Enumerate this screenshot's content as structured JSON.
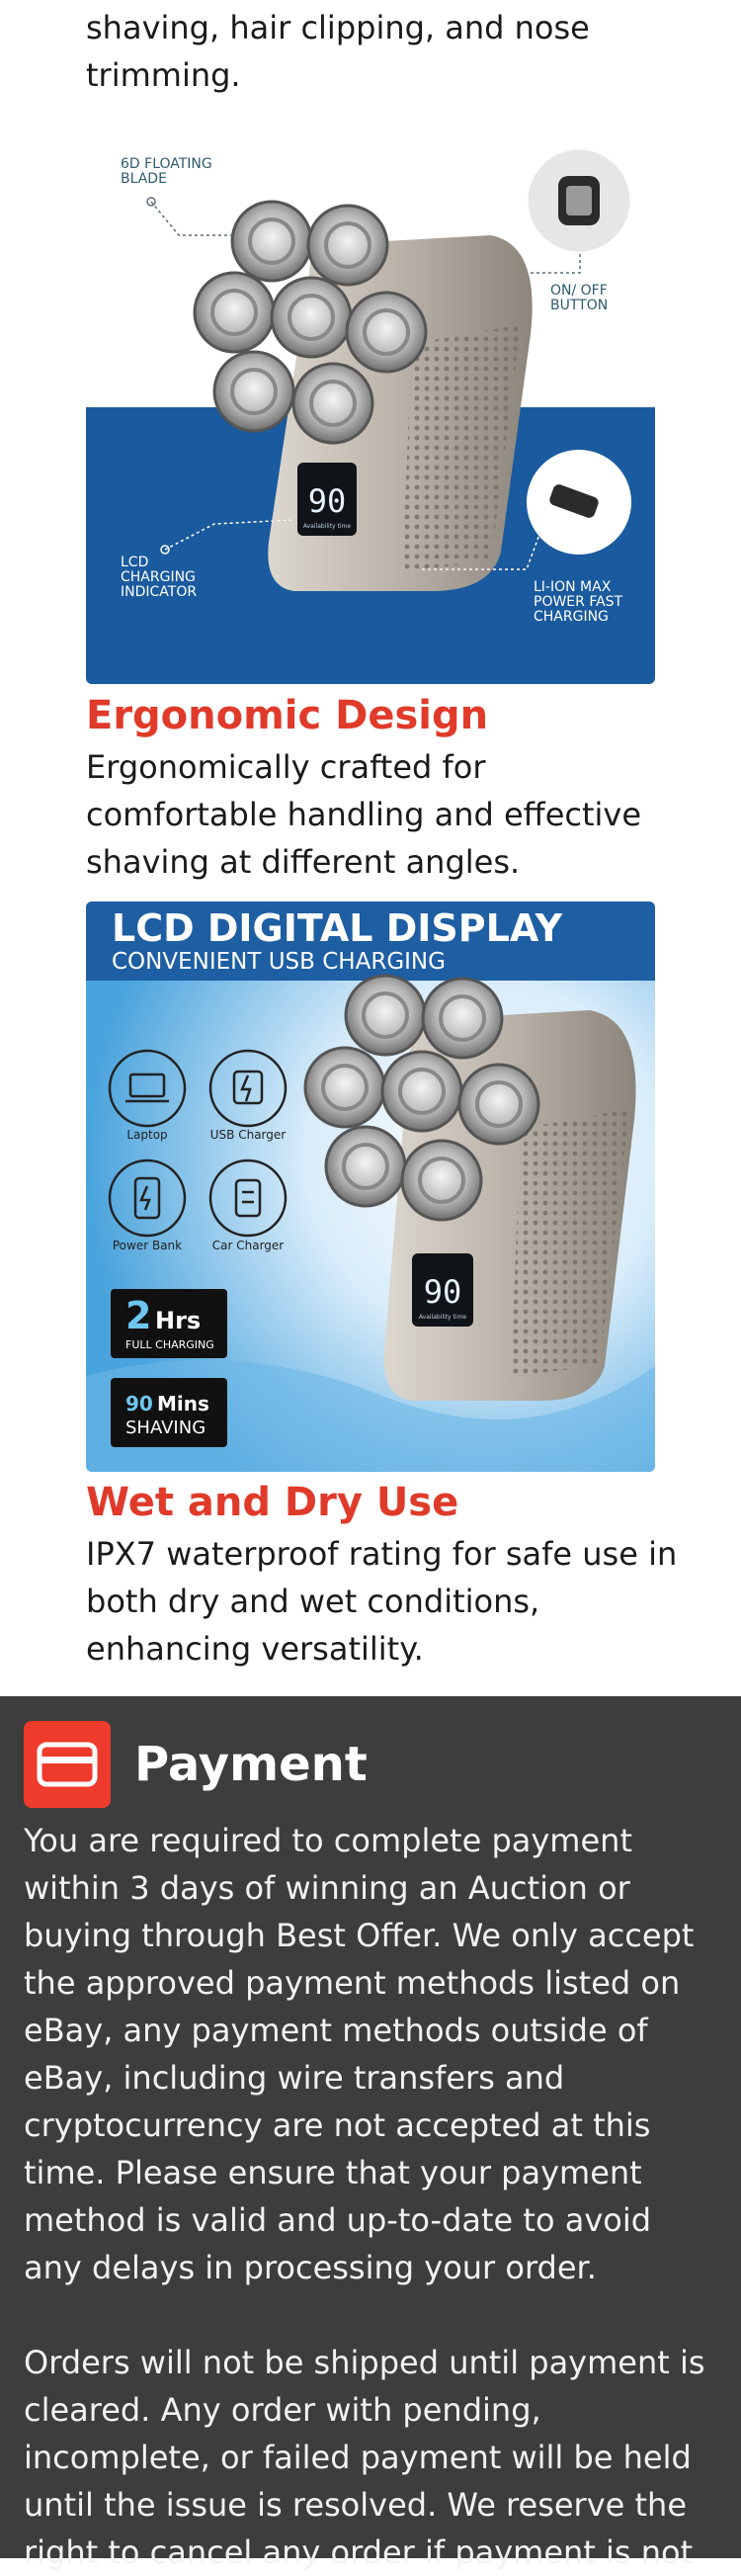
{
  "intro": {
    "text_tail": "shaving, hair clipping, and nose trimming."
  },
  "image1": {
    "blade_label": "6D FLOATING BLADE",
    "onoff_label": "ON/ OFF BUTTON",
    "lcd_label": "LCD CHARGING INDICATOR",
    "liion_label": "LI-ION MAX POWER FAST CHARGING",
    "screen_number": "90",
    "screen_sub": "Availability time"
  },
  "features": [
    {
      "heading": "Ergonomic Design",
      "text": "Ergonomically crafted for comfortable handling and effective shaving at different angles."
    },
    {
      "heading": "Wet and Dry Use",
      "text": "IPX7 waterproof rating for safe use in both dry and wet conditions, enhancing versatility."
    }
  ],
  "image2": {
    "title": "LCD DIGITAL DISPLAY",
    "subtitle": "CONVENIENT USB CHARGING",
    "icons": [
      {
        "label": "Laptop",
        "icon": "laptop-icon"
      },
      {
        "label": "USB Charger",
        "icon": "usb-charger-icon"
      },
      {
        "label": "Power Bank",
        "icon": "power-bank-icon"
      },
      {
        "label": "Car Charger",
        "icon": "car-charger-icon"
      }
    ],
    "badge1_big": "2",
    "badge1_unit": "Hrs",
    "badge1_sub": "FULL CHARGING",
    "badge2_big": "90",
    "badge2_unit": "Mins",
    "badge2_sub": "SHAVING",
    "screen_number": "90",
    "screen_sub": "Availability time"
  },
  "payment": {
    "icon": "credit-card-icon",
    "title": "Payment",
    "paragraph1": "You are required to complete payment within 3 days of winning an Auction or buying through Best Offer. We only accept the approved payment methods listed on eBay, any payment methods outside of eBay, including wire transfers and cryptocurrency are not accepted at this time. Please ensure that your payment method is valid and up-to-date to avoid any delays in processing your order.",
    "paragraph2": "Orders will not be shipped until payment is cleared. Any order with pending, incomplete, or failed payment will be held until the issue is resolved. We reserve the right to cancel any order if payment is not"
  },
  "colors": {
    "accent_red": "#e03a2a",
    "brand_blue": "#1a5a9e",
    "payment_bg": "#3d3d3d",
    "payment_icon_bg": "#ee3b2b"
  }
}
